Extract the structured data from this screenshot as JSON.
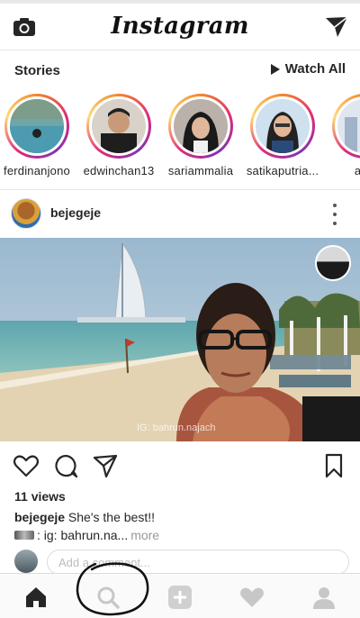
{
  "app": {
    "title": "Instagram"
  },
  "stories": {
    "title": "Stories",
    "watch_all": "Watch All",
    "items": [
      {
        "username": "ferdinanjono"
      },
      {
        "username": "edwinchan13"
      },
      {
        "username": "sariammalia"
      },
      {
        "username": "satikaputria..."
      },
      {
        "username": "and"
      }
    ]
  },
  "post": {
    "username": "bejegeje",
    "watermark": "IG: bahrun.najach",
    "views": "11 views",
    "caption_user": "bejegeje",
    "caption_text": " She's the best!!",
    "caption2_text": ": ig: bahrun.na...",
    "more": "more",
    "comment_placeholder": "Add a comment..."
  },
  "colors": {
    "text": "#262626",
    "muted": "#999999",
    "story_ring_start": "#f58529",
    "story_ring_mid": "#dd2a7b",
    "story_ring_end": "#8134af",
    "nav_inactive": "#c7c7c7",
    "annotation": "#111111"
  },
  "icons": {
    "top_left": "camera-icon",
    "top_right": "direct-send-icon",
    "post_actions": [
      "heart-icon",
      "comment-icon",
      "share-icon",
      "bookmark-icon"
    ],
    "bottom_nav": [
      "home-icon",
      "search-icon",
      "add-icon",
      "activity-heart-icon",
      "profile-icon"
    ]
  }
}
